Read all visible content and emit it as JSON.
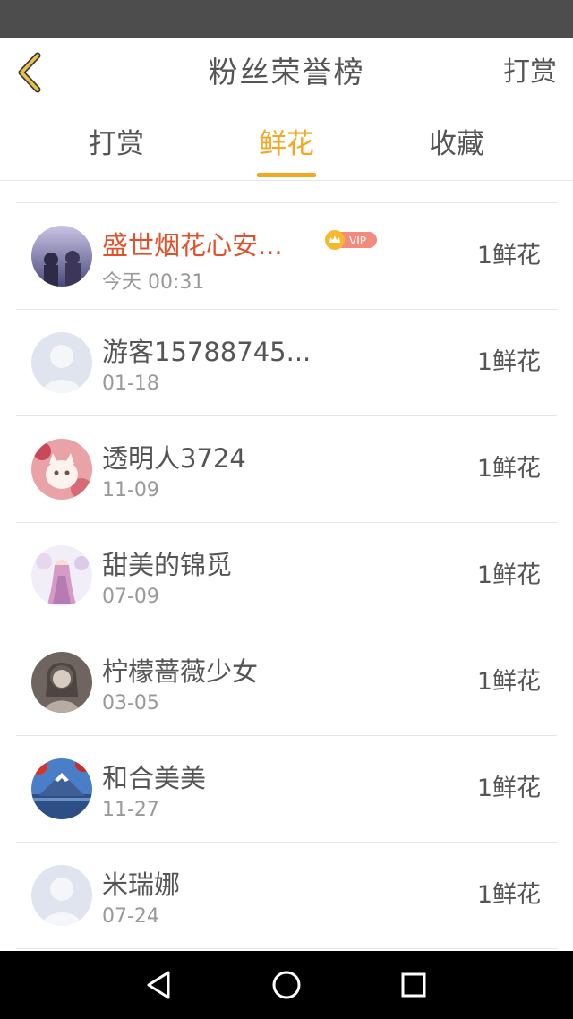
{
  "header": {
    "title": "粉丝荣誉榜",
    "action_label": "打赏"
  },
  "tabs": [
    {
      "label": "打赏",
      "active": false
    },
    {
      "label": "鲜花",
      "active": true
    },
    {
      "label": "收藏",
      "active": false
    }
  ],
  "colors": {
    "accent": "#f5a623",
    "vip_name": "#e0522c",
    "text": "#555555",
    "muted": "#999999"
  },
  "list": [
    {
      "name": "盛世烟花心安...",
      "date": "今天 00:31",
      "count": "1鲜花",
      "vip": true,
      "badge": "VIP",
      "avatar": "avatar-photo-people-icon"
    },
    {
      "name": "游客15788745...",
      "date": "01-18",
      "count": "1鲜花",
      "vip": false,
      "avatar": "default-avatar-icon"
    },
    {
      "name": "透明人3724",
      "date": "11-09",
      "count": "1鲜花",
      "vip": false,
      "avatar": "avatar-photo-cat-icon"
    },
    {
      "name": "甜美的锦觅",
      "date": "07-09",
      "count": "1鲜花",
      "vip": false,
      "avatar": "avatar-photo-girl-icon"
    },
    {
      "name": "柠檬蔷薇少女",
      "date": "03-05",
      "count": "1鲜花",
      "vip": false,
      "avatar": "avatar-photo-portrait-icon"
    },
    {
      "name": "和合美美",
      "date": "11-27",
      "count": "1鲜花",
      "vip": false,
      "avatar": "avatar-photo-mountain-icon"
    },
    {
      "name": "米瑞娜",
      "date": "07-24",
      "count": "1鲜花",
      "vip": false,
      "avatar": "default-avatar-icon"
    }
  ],
  "navbar": {
    "buttons": [
      "back-triangle-icon",
      "home-circle-icon",
      "recents-square-icon"
    ]
  }
}
